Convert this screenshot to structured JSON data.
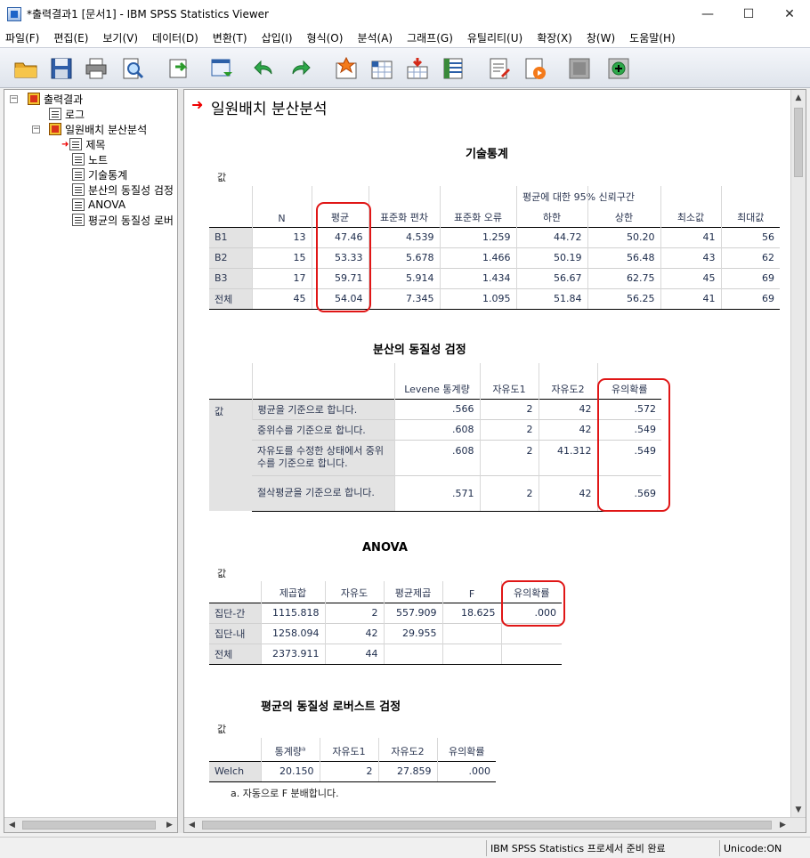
{
  "window": {
    "title": "*출력결과1 [문서1] - IBM SPSS Statistics Viewer",
    "minimize": "—",
    "maximize": "☐",
    "close": "✕"
  },
  "menu": [
    "파일(F)",
    "편집(E)",
    "보기(V)",
    "데이터(D)",
    "변환(T)",
    "삽입(I)",
    "형식(O)",
    "분석(A)",
    "그래프(G)",
    "유틸리티(U)",
    "확장(X)",
    "창(W)",
    "도움말(H)"
  ],
  "toolbar_icons": [
    "open-icon",
    "save-icon",
    "print-icon",
    "print-preview-icon",
    "export-icon",
    "recall-dialog-icon",
    "undo-icon",
    "redo-icon",
    "goto-data-icon",
    "goto-case-icon",
    "goto-variable-icon",
    "variables-icon",
    "insert-output-icon",
    "show-output-icon",
    "designate-window-icon",
    "add-icon"
  ],
  "tree": {
    "root": "출력결과",
    "log": "로그",
    "analysis": "일원배치 분산분석",
    "children": [
      "제목",
      "노트",
      "기술통계",
      "분산의 동질성 검정",
      "ANOVA",
      "평균의 동질성 로버"
    ]
  },
  "output": {
    "main_title": "일원배치 분산분석",
    "descriptives": {
      "title": "기술통계",
      "var_label": "값",
      "ci_header": "평균에 대한 95% 신뢰구간",
      "columns": [
        "N",
        "평균",
        "표준화 편차",
        "표준화 오류",
        "하한",
        "상한",
        "최소값",
        "최대값"
      ],
      "rows": [
        {
          "label": "B1",
          "cells": [
            "13",
            "47.46",
            "4.539",
            "1.259",
            "44.72",
            "50.20",
            "41",
            "56"
          ]
        },
        {
          "label": "B2",
          "cells": [
            "15",
            "53.33",
            "5.678",
            "1.466",
            "50.19",
            "56.48",
            "43",
            "62"
          ]
        },
        {
          "label": "B3",
          "cells": [
            "17",
            "59.71",
            "5.914",
            "1.434",
            "56.67",
            "62.75",
            "45",
            "69"
          ]
        },
        {
          "label": "전체",
          "cells": [
            "45",
            "54.04",
            "7.345",
            "1.095",
            "51.84",
            "56.25",
            "41",
            "69"
          ]
        }
      ]
    },
    "levene": {
      "title": "분산의 동질성 검정",
      "var_label": "값",
      "columns": [
        "Levene 통계량",
        "자유도1",
        "자유도2",
        "유의확률"
      ],
      "rows": [
        {
          "label": "평균을 기준으로 합니다.",
          "cells": [
            ".566",
            "2",
            "42",
            ".572"
          ]
        },
        {
          "label": "중위수를 기준으로 합니다.",
          "cells": [
            ".608",
            "2",
            "42",
            ".549"
          ]
        },
        {
          "label": "자유도를 수정한 상태에서 중위수를 기준으로 합니다.",
          "cells": [
            ".608",
            "2",
            "41.312",
            ".549"
          ]
        },
        {
          "label": "절삭평균을 기준으로 합니다.",
          "cells": [
            ".571",
            "2",
            "42",
            ".569"
          ]
        }
      ]
    },
    "anova": {
      "title": "ANOVA",
      "var_label": "값",
      "columns": [
        "제곱합",
        "자유도",
        "평균제곱",
        "F",
        "유의확률"
      ],
      "rows": [
        {
          "label": "집단-간",
          "cells": [
            "1115.818",
            "2",
            "557.909",
            "18.625",
            ".000"
          ]
        },
        {
          "label": "집단-내",
          "cells": [
            "1258.094",
            "42",
            "29.955",
            "",
            ""
          ]
        },
        {
          "label": "전체",
          "cells": [
            "2373.911",
            "44",
            "",
            "",
            ""
          ]
        }
      ]
    },
    "robust": {
      "title": "평균의 동질성 로버스트 검정",
      "var_label": "값",
      "columns": [
        "통계량",
        "자유도1",
        "자유도2",
        "유의확률"
      ],
      "stat_superscript": "a",
      "rows": [
        {
          "label": "Welch",
          "cells": [
            "20.150",
            "2",
            "27.859",
            ".000"
          ]
        }
      ],
      "footnote": "a. 자동으로 F 분배합니다."
    }
  },
  "status": {
    "processor": "IBM SPSS Statistics 프로세서 준비 완료",
    "unicode": "Unicode:ON"
  }
}
